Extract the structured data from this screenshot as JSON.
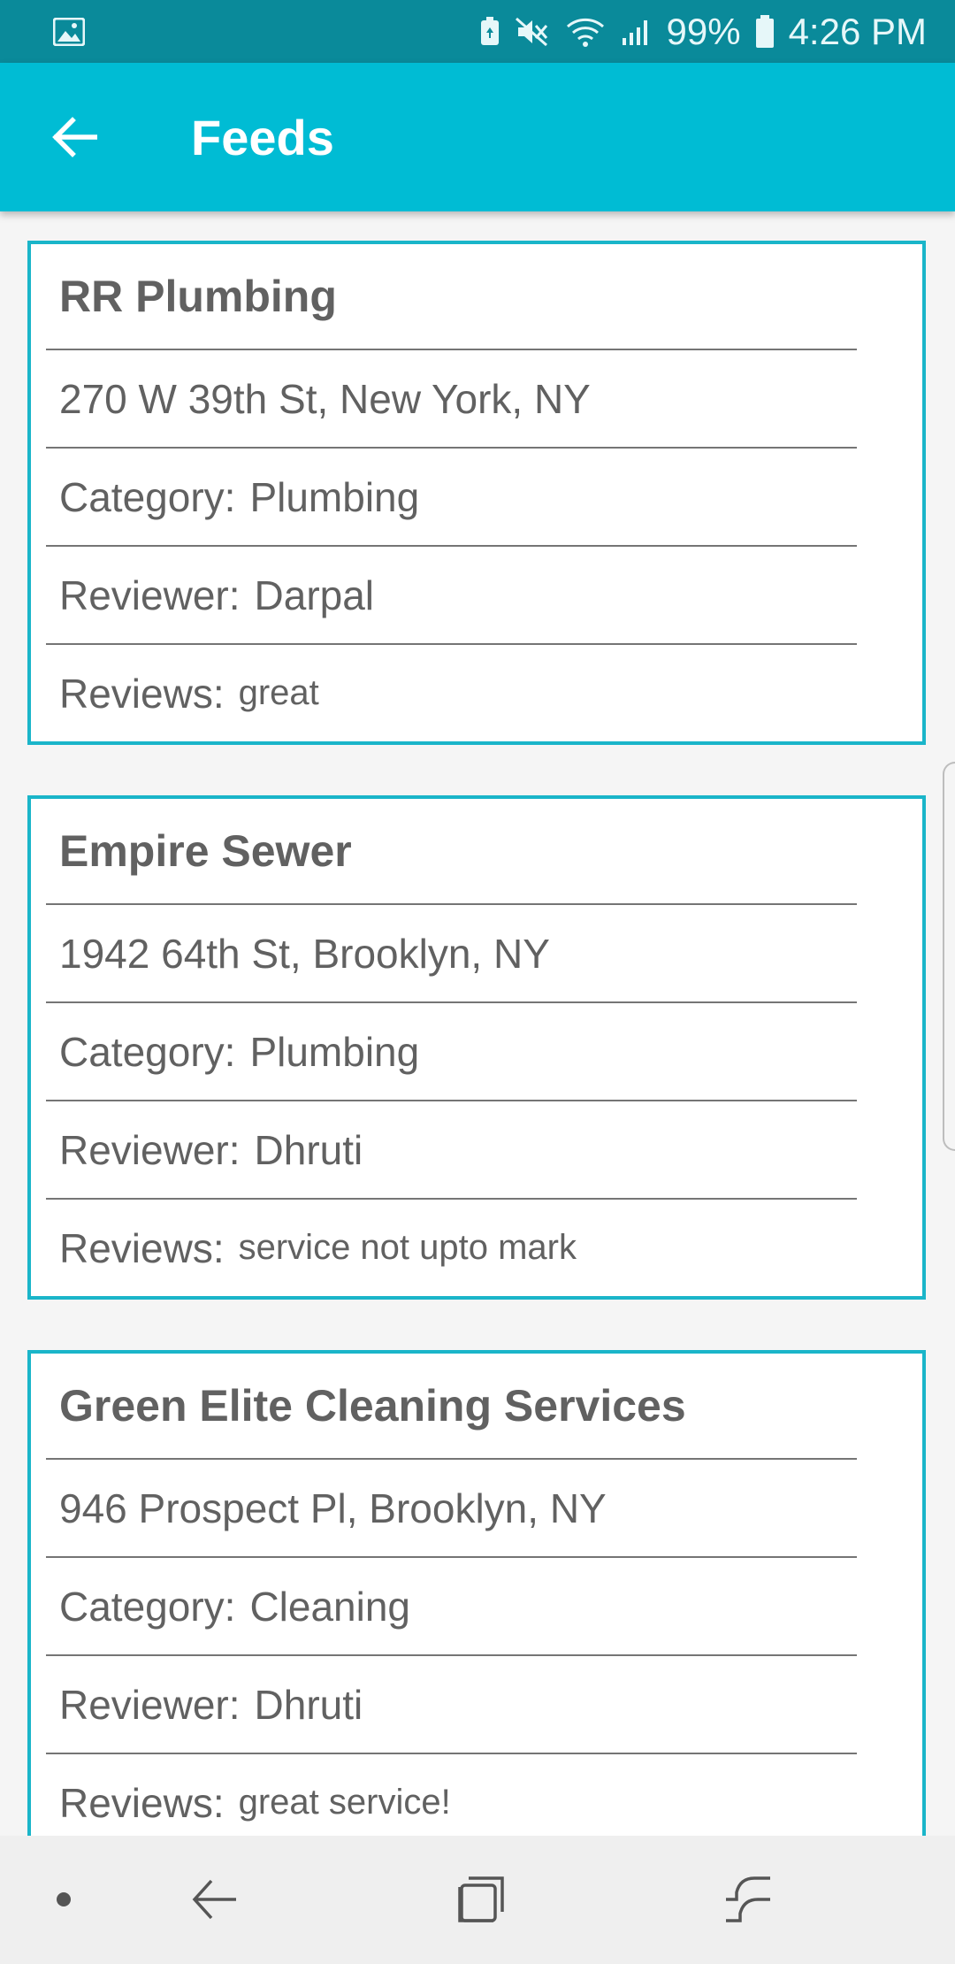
{
  "status_bar": {
    "battery_percent": "99%",
    "time": "4:26 PM",
    "icons": [
      "gallery-notification-icon",
      "battery-saver-icon",
      "mute-icon",
      "wifi-icon",
      "signal-icon",
      "battery-icon"
    ]
  },
  "app_bar": {
    "title": "Feeds",
    "back_icon": "arrow-back-icon",
    "background": "#00bcd4"
  },
  "feeds": [
    {
      "name": "RR Plumbing",
      "address": "270 W 39th St, New York, NY",
      "category_label": "Category:",
      "category": "Plumbing",
      "reviewer_label": "Reviewer:",
      "reviewer": "Darpal",
      "reviews_label": "Reviews:",
      "review": "great"
    },
    {
      "name": "Empire Sewer",
      "address": "1942 64th St, Brooklyn, NY",
      "category_label": "Category:",
      "category": "Plumbing",
      "reviewer_label": "Reviewer:",
      "reviewer": "Dhruti",
      "reviews_label": "Reviews:",
      "review": "service not upto mark"
    },
    {
      "name": "Green Elite Cleaning Services",
      "address": "946 Prospect Pl, Brooklyn, NY",
      "category_label": "Category:",
      "category": "Cleaning",
      "reviewer_label": "Reviewer:",
      "reviewer": "Dhruti",
      "reviews_label": "Reviews:",
      "review": "great service!"
    }
  ],
  "nav_bar": {
    "icons": [
      "dot-icon",
      "back-arrow-icon",
      "recent-apps-icon",
      "home-icon"
    ]
  },
  "colors": {
    "accent": "#00bcd4",
    "status_bar": "#0a8a9a",
    "card_border": "#1ab5c9",
    "text": "#616161"
  }
}
